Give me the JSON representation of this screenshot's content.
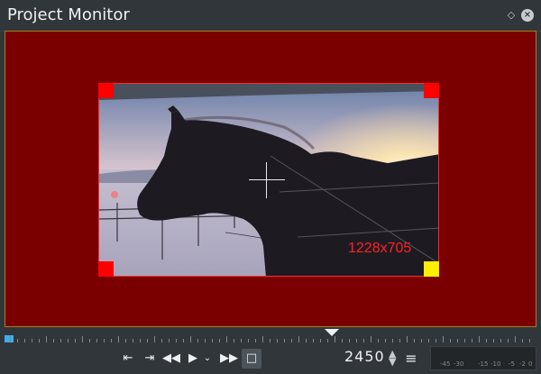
{
  "window": {
    "title": "Project Monitor",
    "float_icon": "diamond-icon",
    "close_icon": "close-icon"
  },
  "monitor": {
    "background_color": "#7a0000",
    "frame_border_color": "#ff2a2a",
    "dimensions_label": "1228x705",
    "handle_colors": {
      "corner": "#ff0000",
      "active_corner": "#ffee00"
    }
  },
  "toolbar": {
    "set_zone_in_icon": "zone-in-icon",
    "set_zone_out_icon": "zone-out-icon",
    "rewind_icon": "rewind-icon",
    "play_icon": "play-icon",
    "play_options_icon": "chevron-down-icon",
    "forward_icon": "fast-forward-icon",
    "edit_mode_icon": "transform-icon",
    "timecode": "2450",
    "menu_icon": "hamburger-menu-icon"
  },
  "audio_meter": {
    "scale": [
      "-45",
      "-30",
      "-15",
      "-10",
      "-5",
      "-2",
      "0"
    ]
  },
  "accent_color": "#3daee9"
}
